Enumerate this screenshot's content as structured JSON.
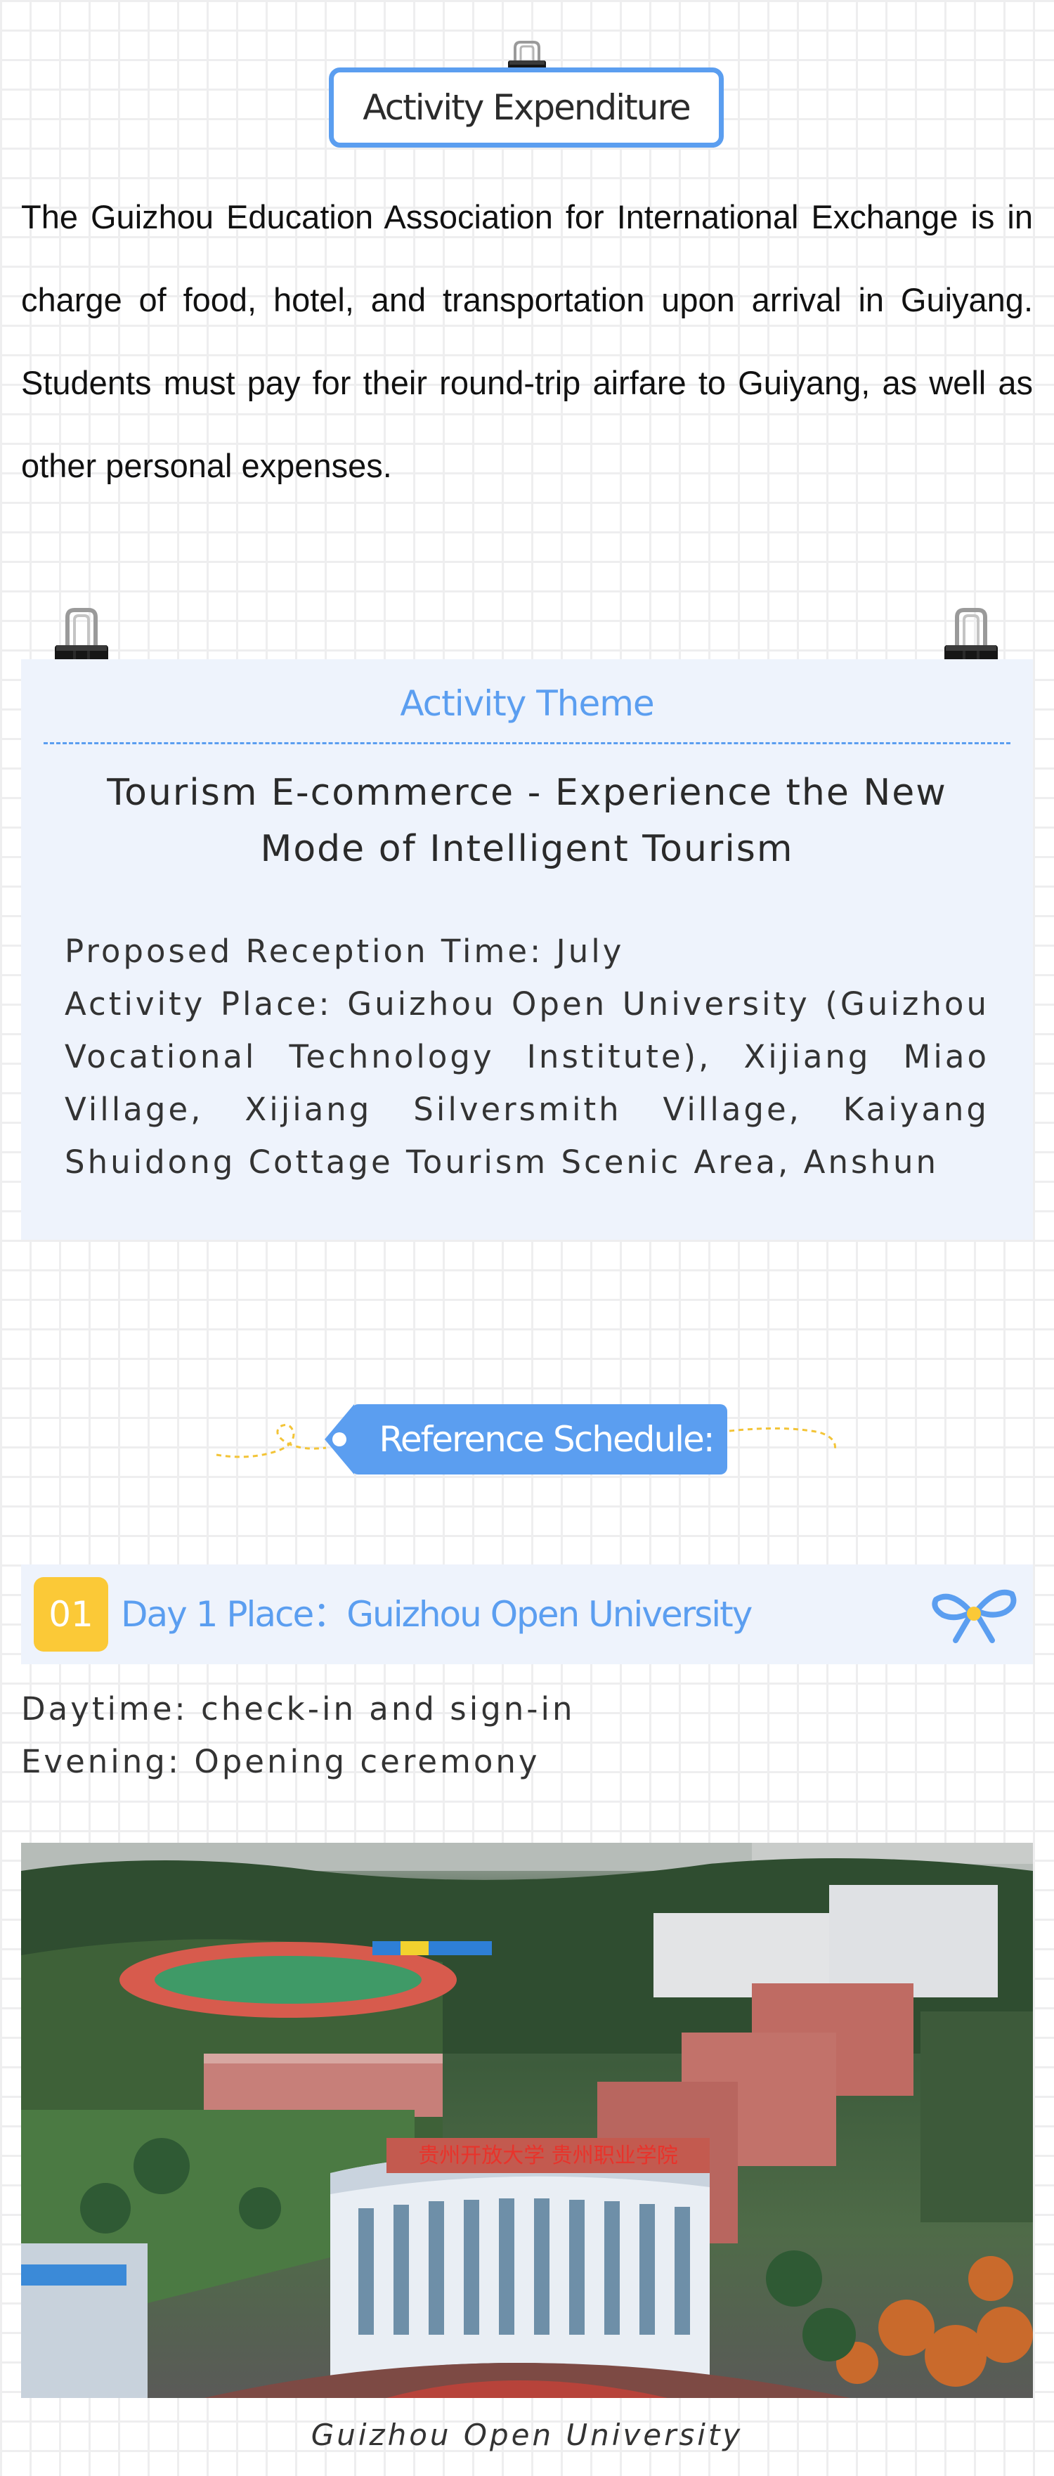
{
  "expenditure": {
    "title": "Activity Expenditure",
    "body": "The Guizhou Education Association for International Exchange is in charge of food, hotel, and transportation upon arrival in Guiyang. Students must pay for their round-trip airfare to Guiyang, as well as other personal expenses."
  },
  "theme": {
    "label": "Activity Theme",
    "heading": "Tourism E-commerce - Experience the New Mode of Intelligent Tourism",
    "reception_time": "Proposed Reception Time: July",
    "activity_place": "Activity Place: Guizhou Open University (Guizhou Vocational Technology Institute), Xijiang Miao Village, Xijiang Silversmith Village, Kaiyang Shuidong Cottage Tourism Scenic Area, Anshun"
  },
  "schedule": {
    "banner": "Reference Schedule:",
    "days": [
      {
        "number": "01",
        "title": "Day 1  Place：Guizhou Open University",
        "daytime": "Daytime: check-in and sign-in",
        "evening": "Evening: Opening ceremony",
        "photo_caption": "Guizhou Open University",
        "photo_sign": "贵州开放大学 贵州职业学院"
      }
    ]
  },
  "colors": {
    "accent": "#5b9ef0",
    "card_bg": "#eef3fc",
    "day_badge": "#fbc937"
  },
  "icons": [
    "binder-clip-icon",
    "ribbon-bow-icon",
    "dashed-swirl-decoration"
  ]
}
